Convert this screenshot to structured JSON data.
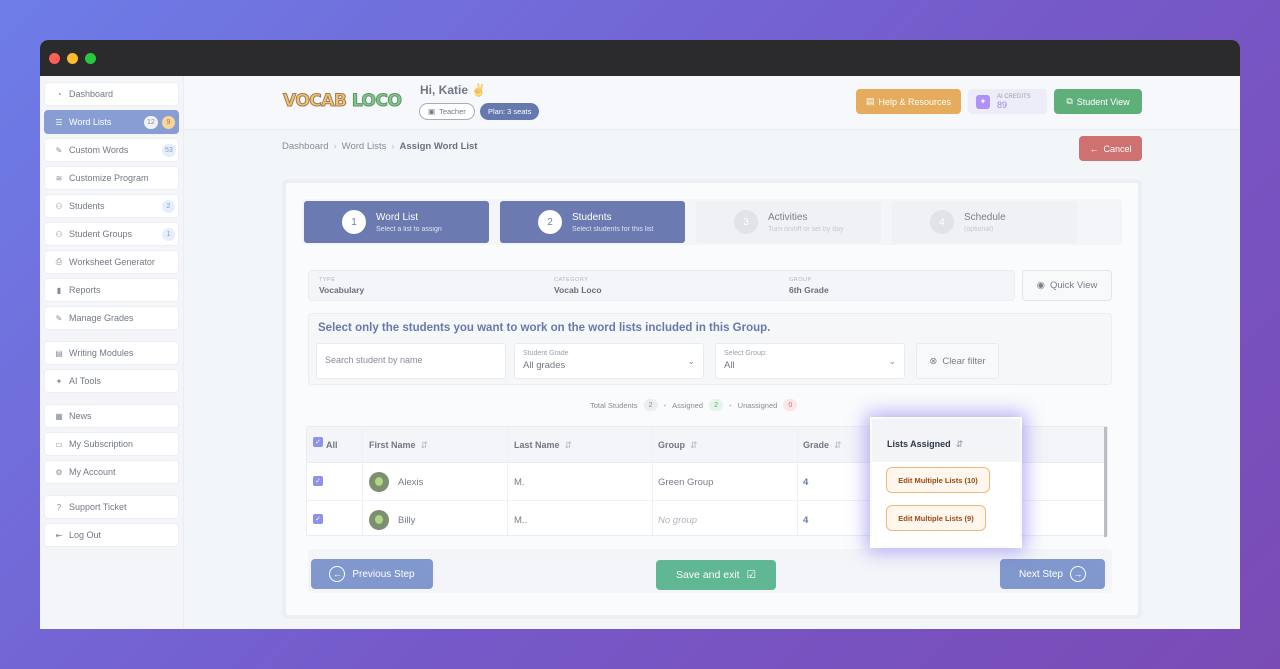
{
  "sidebar": {
    "items": [
      {
        "label": "Dashboard",
        "icon": "dashboard-icon"
      },
      {
        "label": "Word Lists",
        "icon": "list-icon",
        "badge1": "12",
        "badge2": "9",
        "active": true
      },
      {
        "label": "Custom Words",
        "icon": "edit-icon",
        "badge1": "53"
      },
      {
        "label": "Customize Program",
        "icon": "sliders-icon"
      },
      {
        "label": "Students",
        "icon": "users-icon",
        "badge1": "2"
      },
      {
        "label": "Student Groups",
        "icon": "group-icon",
        "badge1": "1"
      },
      {
        "label": "Worksheet Generator",
        "icon": "printer-icon"
      },
      {
        "label": "Reports",
        "icon": "bar-chart-icon"
      },
      {
        "label": "Manage Grades",
        "icon": "edit-icon"
      },
      {
        "label": "Writing Modules",
        "icon": "book-icon"
      },
      {
        "label": "AI Tools",
        "icon": "sparkle-icon"
      },
      {
        "label": "News",
        "icon": "news-icon"
      },
      {
        "label": "My Subscription",
        "icon": "card-icon"
      },
      {
        "label": "My Account",
        "icon": "gear-icon"
      },
      {
        "label": "Support Ticket",
        "icon": "help-icon"
      },
      {
        "label": "Log Out",
        "icon": "logout-icon"
      }
    ]
  },
  "header": {
    "logo_text_1": "VOCAB",
    "logo_text_2": "LOCO",
    "greeting": "Hi, Katie ✌",
    "role_chip": "Teacher",
    "plan_chip": "Plan: 3 seats",
    "help_label": "Help & Resources",
    "credits_label": "AI CREDITS",
    "credits_value": "89",
    "student_view_label": "Student View"
  },
  "breadcrumb": {
    "items": [
      "Dashboard",
      "Word Lists",
      "Assign Word List"
    ],
    "separator": "›"
  },
  "cancel_label": "Cancel",
  "steps": [
    {
      "num": "1",
      "title": "Word List",
      "subtitle": "Select a list to assign"
    },
    {
      "num": "2",
      "title": "Students",
      "subtitle": "Select students for this list"
    },
    {
      "num": "3",
      "title": "Activities",
      "subtitle": "Turn on/off or set by day"
    },
    {
      "num": "4",
      "title": "Schedule",
      "subtitle": "(optional)"
    }
  ],
  "meta": {
    "type_label": "TYPE",
    "type_value": "Vocabulary",
    "category_label": "CATEGORY",
    "category_value": "Vocab Loco",
    "group_label": "GROUP",
    "group_value": "6th Grade"
  },
  "quick_view_label": "Quick View",
  "filters": {
    "heading": "Select only the students you want to work on the word lists included in this Group.",
    "search_placeholder": "Search student by name",
    "grade_label": "Student Grade",
    "grade_value": "All grades",
    "group_label": "Select Group:",
    "group_value": "All",
    "clear_label": "Clear filter"
  },
  "stats": {
    "total_label": "Total Students",
    "total": "2",
    "assigned_label": "Assigned",
    "assigned": "2",
    "unassigned_label": "Unassigned",
    "unassigned": "0",
    "dot": "•"
  },
  "table": {
    "headers": {
      "all": "All",
      "first": "First Name",
      "last": "Last Name",
      "group": "Group",
      "grade": "Grade",
      "lists": "Lists Assigned"
    },
    "sort_glyph": "⇵",
    "rows": [
      {
        "first": "Alexis",
        "last": "M.",
        "group": "Green Group",
        "grade": "4",
        "lists": "Edit Multiple Lists (10)"
      },
      {
        "first": "Billy",
        "last": "M..",
        "group": "No group",
        "grade": "4",
        "lists": "Edit Multiple Lists (9)"
      }
    ]
  },
  "footer": {
    "prev_label": "Previous Step",
    "save_label": "Save and exit",
    "next_label": "Next Step"
  },
  "colors": {
    "accent": "#253b8c",
    "success": "#169560",
    "danger": "#b82e2e",
    "warning": "#d7850f"
  }
}
